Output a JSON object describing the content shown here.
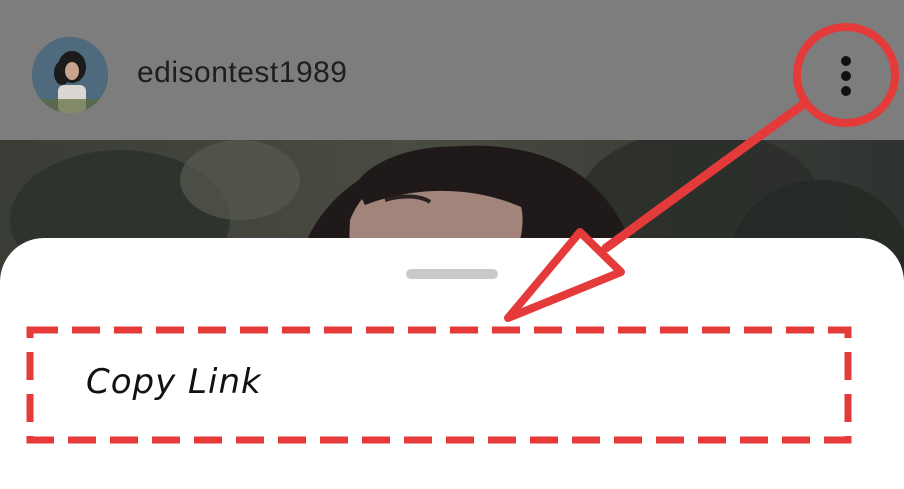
{
  "header": {
    "username": "edisontest1989"
  },
  "sheet": {
    "items": [
      {
        "label": "Copy Link"
      }
    ]
  },
  "icons": {
    "more": "more-vertical-icon",
    "avatar": "profile-photo"
  },
  "colors": {
    "overlay": "#7b7b7b",
    "annotation_red": "#e53a3a",
    "sheet_background": "#ffffff",
    "drag_handle": "#c9c9c9"
  }
}
